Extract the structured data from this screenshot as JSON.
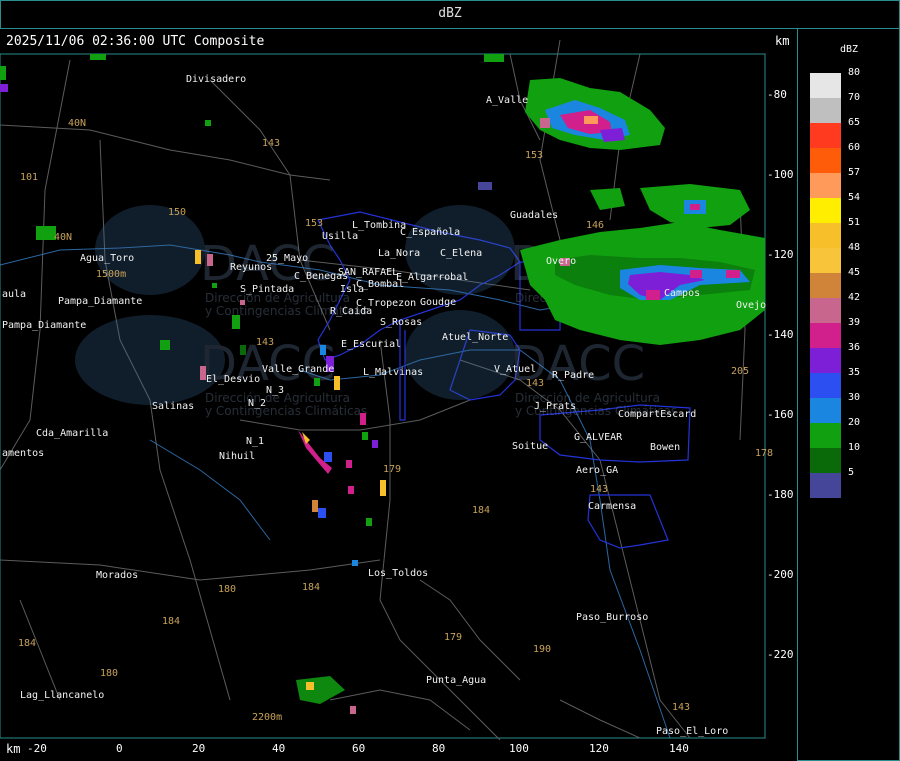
{
  "header": {
    "title": "dBZ",
    "timestamp_line": "2025/11/06 02:36:00 UTC Composite",
    "km_label": "km"
  },
  "axes": {
    "x_unit": "km",
    "x_ticks": [
      "-20",
      "0",
      "20",
      "40",
      "60",
      "80",
      "100",
      "120",
      "140"
    ],
    "y_ticks": [
      "-80",
      "-100",
      "-120",
      "-140",
      "-160",
      "-180",
      "-200",
      "-220"
    ]
  },
  "legend": {
    "title": "dBZ",
    "items": [
      {
        "value": "80",
        "color": "#e6e6e6"
      },
      {
        "value": "70",
        "color": "#bfbfbf"
      },
      {
        "value": "65",
        "color": "#ff3a1f"
      },
      {
        "value": "60",
        "color": "#ff5c0a"
      },
      {
        "value": "57",
        "color": "#ff9a5a"
      },
      {
        "value": "54",
        "color": "#ffee00"
      },
      {
        "value": "51",
        "color": "#f7c02b"
      },
      {
        "value": "48",
        "color": "#f7c43a"
      },
      {
        "value": "45",
        "color": "#d0843a"
      },
      {
        "value": "42",
        "color": "#c8668e"
      },
      {
        "value": "39",
        "color": "#d11f8c"
      },
      {
        "value": "36",
        "color": "#7d1fd6"
      },
      {
        "value": "35",
        "color": "#2b4ff0"
      },
      {
        "value": "30",
        "color": "#1a86e0"
      },
      {
        "value": "20",
        "color": "#10a010"
      },
      {
        "value": "10",
        "color": "#0a6a0a"
      },
      {
        "value": "5",
        "color": "#45459a"
      }
    ]
  },
  "places": [
    "Divisadero",
    "A_Valle",
    "Guadales",
    "L_Tombina",
    "C_Española",
    "Usilla",
    "La_Nora",
    "C_Elena",
    "Agua_Toro",
    "SAN_RAFAEL",
    "Reyunos",
    "25_Mayo",
    "C_Benegas",
    "E_Algarrobal",
    "C_Bombal",
    "S_Pintada",
    "Isla",
    "C_Tropezon",
    "Goudge",
    "R_Caida",
    "S_Rosas",
    "Atuel_Norte",
    "E_Escurial",
    "El_Desvio",
    "Valle_Grande",
    "L_Malvinas",
    "V_Atuel",
    "R_Padre",
    "Salinas",
    "J_Prats",
    "Cda_Amarilla",
    "N_1",
    "N_2",
    "N_3",
    "Nihuil",
    "G_ALVEAR",
    "CompartEscard",
    "Bowen",
    "Soitue",
    "Aero_GA",
    "Carmensa",
    "Los_Toldos",
    "Morados",
    "Paso_Burroso",
    "Punta_Agua",
    "Lag_Llancanelo",
    "Paso_El_Loro",
    "Pampa_Diamante",
    "aula",
    "amentos",
    "Overo",
    "Campos",
    "Ovejo"
  ],
  "routes": [
    "40N",
    "101",
    "143",
    "150",
    "153",
    "178",
    "179",
    "184",
    "180",
    "190",
    "143",
    "40N",
    "205",
    "1500m",
    "2200m",
    "153",
    "146"
  ],
  "watermark": {
    "brand": "DACC",
    "line1": "Dirección de Agricultura",
    "line2": "y Contingencias Climáticas"
  },
  "colors": {
    "frame": "#2a8d8d",
    "boundary": "#1f2fd6",
    "river": "#3a8ad8",
    "road": "#6a6a6a"
  }
}
